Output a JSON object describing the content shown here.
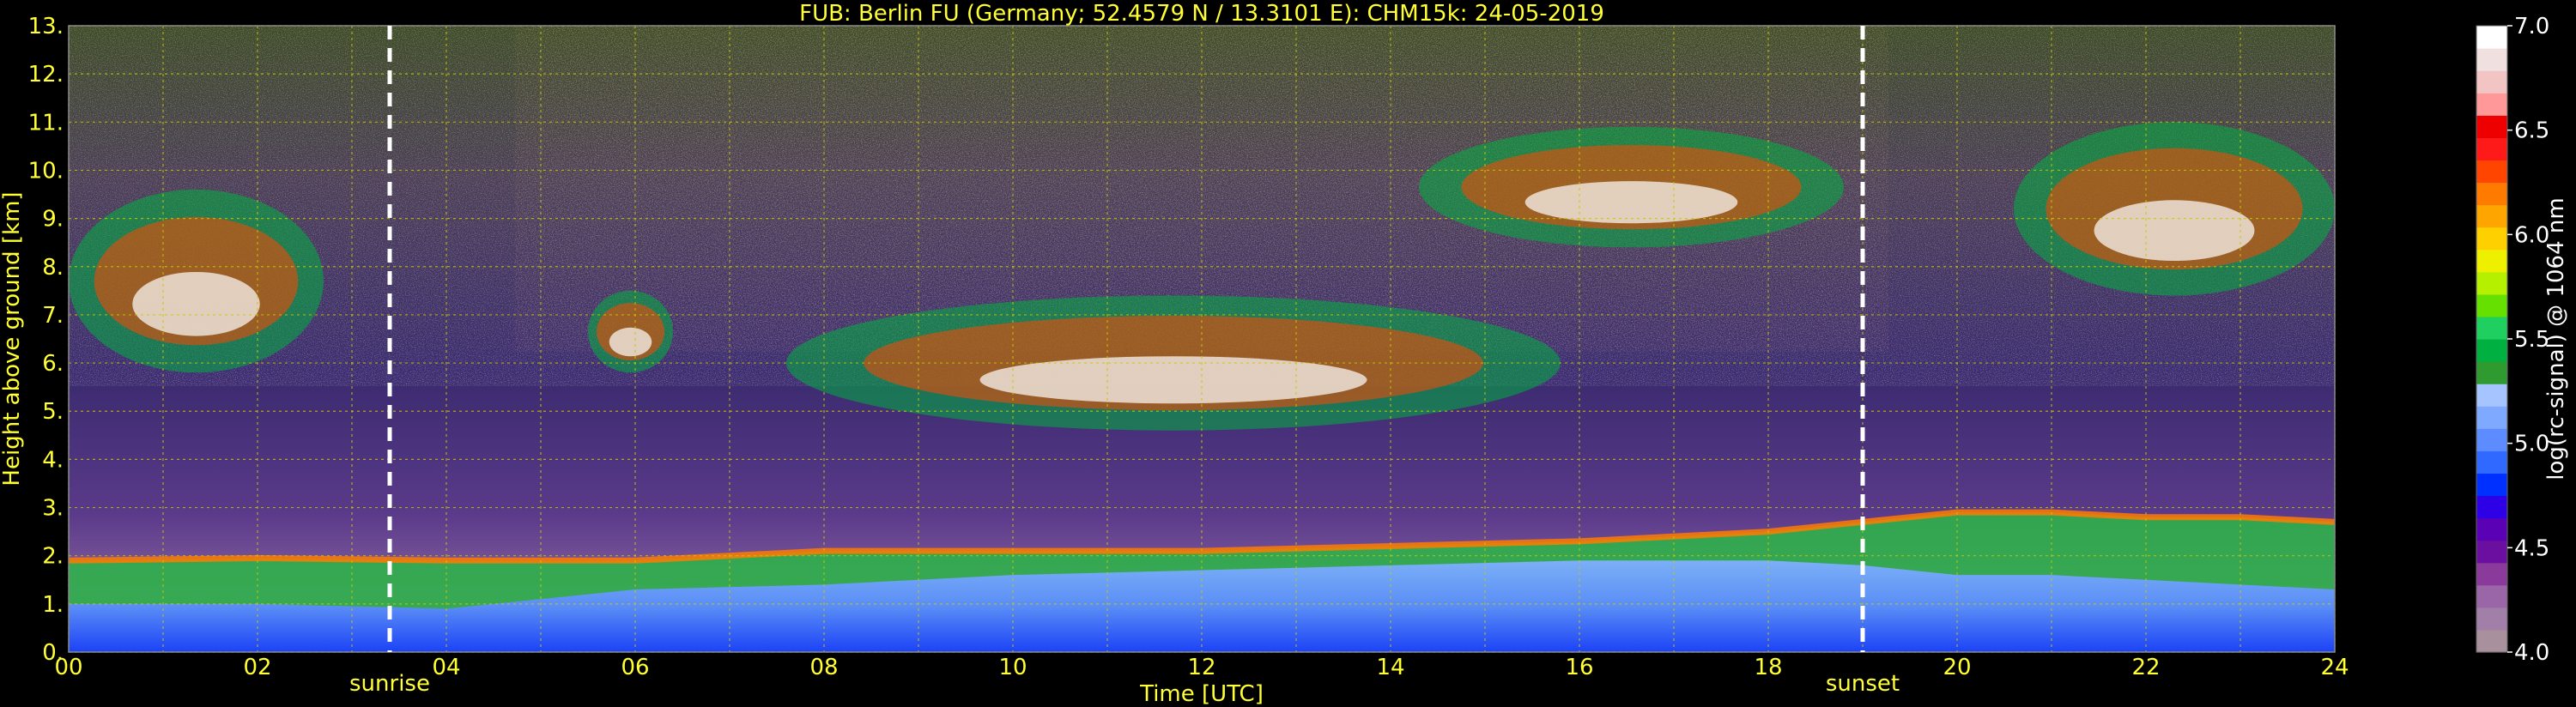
{
  "chart_data": {
    "type": "heatmap",
    "title": "FUB: Berlin FU (Germany; 52.4579 N / 13.3101 E):    CHM15k: 24-05-2019",
    "xlabel": "Time [UTC]",
    "ylabel": "Height above ground [km]",
    "xlim": [
      0,
      24
    ],
    "ylim": [
      0,
      13
    ],
    "x_ticks": [
      "00",
      "02",
      "04",
      "06",
      "08",
      "10",
      "12",
      "14",
      "16",
      "18",
      "20",
      "22",
      "24"
    ],
    "y_ticks": [
      "0.",
      "1.",
      "2.",
      "3.",
      "4.",
      "5.",
      "6.",
      "7.",
      "8.",
      "9.",
      "10.",
      "11.",
      "12.",
      "13."
    ],
    "grid": true,
    "vlines": [
      {
        "label": "sunrise",
        "x": 3.4
      },
      {
        "label": "sunset",
        "x": 19.0
      }
    ],
    "colorbar": {
      "label": "log(rc-signal) @ 1064 nm",
      "range": [
        4.0,
        7.0
      ],
      "ticks": [
        "4.0",
        "4.5",
        "5.0",
        "5.5",
        "6.0",
        "6.5",
        "7.0"
      ],
      "colors": [
        "#a8909c",
        "#a17fa9",
        "#9a66a8",
        "#8a3a9a",
        "#6a0fa0",
        "#5a00b5",
        "#2d00e5",
        "#0030ff",
        "#2f69ff",
        "#5c8cff",
        "#7fa8ff",
        "#a6c4ff",
        "#2f9a2f",
        "#00b040",
        "#1fd060",
        "#66e000",
        "#b4f000",
        "#eef000",
        "#ffd000",
        "#ffa500",
        "#ff7b00",
        "#ff4500",
        "#ff1a1a",
        "#ee0000",
        "#ff9999",
        "#f2c4c4",
        "#f0e0e0",
        "#ffffff"
      ]
    },
    "features": [
      {
        "name": "boundary layer",
        "x": [
          0,
          2,
          4,
          6,
          8,
          10,
          12,
          14,
          16,
          18,
          19,
          20,
          21,
          22,
          23,
          24
        ],
        "top": [
          1.9,
          1.95,
          1.9,
          1.9,
          2.1,
          2.1,
          2.1,
          2.2,
          2.3,
          2.5,
          2.7,
          2.9,
          2.9,
          2.8,
          2.8,
          2.7
        ],
        "mid": [
          1.0,
          1.0,
          0.9,
          1.3,
          1.4,
          1.6,
          1.7,
          1.8,
          1.9,
          1.9,
          1.8,
          1.6,
          1.6,
          1.5,
          1.4,
          1.3
        ]
      },
      {
        "name": "cloud",
        "x0": 0.0,
        "x1": 2.7,
        "y0": 5.8,
        "y1": 9.6
      },
      {
        "name": "cloud",
        "x0": 5.5,
        "x1": 6.4,
        "y0": 5.8,
        "y1": 7.5
      },
      {
        "name": "cloud",
        "x0": 7.6,
        "x1": 15.8,
        "y0": 4.6,
        "y1": 7.4
      },
      {
        "name": "cloud",
        "x0": 14.3,
        "x1": 18.8,
        "y0": 8.4,
        "y1": 10.9
      },
      {
        "name": "cloud",
        "x0": 20.6,
        "x1": 24.0,
        "y0": 7.4,
        "y1": 11.0
      }
    ]
  }
}
